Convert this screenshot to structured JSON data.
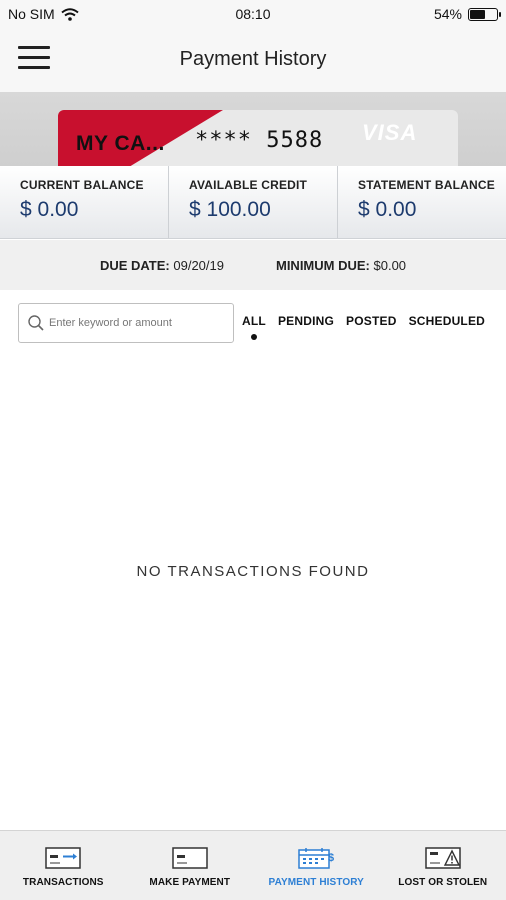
{
  "status_bar": {
    "carrier": "No SIM",
    "time": "08:10",
    "battery": "54%",
    "battery_level": 0.54
  },
  "header": {
    "title": "Payment History"
  },
  "card": {
    "name": "MY CA...",
    "number": "**** 5588",
    "network": "VISA",
    "accent_color": "#c8102e"
  },
  "balances": [
    {
      "label": "CURRENT BALANCE",
      "value": "$ 0.00"
    },
    {
      "label": "AVAILABLE CREDIT",
      "value": "$ 100.00"
    },
    {
      "label": "STATEMENT BALANCE",
      "value": "$ 0.00"
    }
  ],
  "due": {
    "date_label": "DUE DATE:",
    "date_value": "09/20/19",
    "min_label": "MINIMUM DUE:",
    "min_value": "$0.00"
  },
  "search": {
    "placeholder": "Enter keyword or amount",
    "value": ""
  },
  "filters": {
    "tabs": [
      "ALL",
      "PENDING",
      "POSTED",
      "SCHEDULED"
    ],
    "active": "ALL"
  },
  "empty_message": "NO TRANSACTIONS FOUND",
  "bottom_nav": {
    "items": [
      {
        "label": "TRANSACTIONS",
        "icon": "card-transfer-icon"
      },
      {
        "label": "MAKE PAYMENT",
        "icon": "card-payment-icon"
      },
      {
        "label": "PAYMENT HISTORY",
        "icon": "calendar-dollar-icon"
      },
      {
        "label": "LOST OR STOLEN",
        "icon": "card-warning-icon"
      }
    ],
    "active": "PAYMENT HISTORY",
    "active_color": "#2d7fd4"
  }
}
